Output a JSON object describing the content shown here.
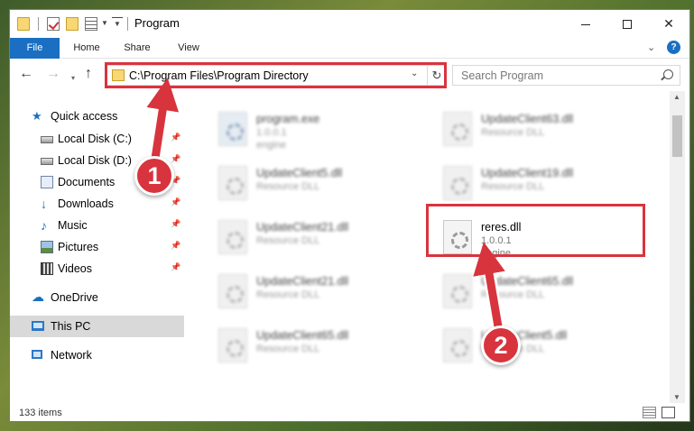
{
  "window": {
    "title": "Program",
    "controls": {
      "minimize": "",
      "maximize": "",
      "close": "✕"
    }
  },
  "ribbon": {
    "tabs": [
      "File",
      "Home",
      "Share",
      "View"
    ],
    "expand": "⌄",
    "help": "?"
  },
  "navbar": {
    "back": "←",
    "forward": "→",
    "recent": "▾",
    "up": "↑",
    "address": "C:\\Program Files\\Program Directory",
    "address_dropdown": "⌄",
    "refresh": "↻",
    "search_placeholder": "Search Program"
  },
  "sidebar": {
    "items": [
      {
        "label": "Quick access",
        "icon": "star-icon",
        "pinned": false
      },
      {
        "label": "Local Disk (C:)",
        "icon": "disk-icon",
        "pinned": true
      },
      {
        "label": "Local Disk (D:)",
        "icon": "disk-icon",
        "pinned": true
      },
      {
        "label": "Documents",
        "icon": "documents-icon",
        "pinned": true
      },
      {
        "label": "Downloads",
        "icon": "download-icon",
        "pinned": true
      },
      {
        "label": "Music",
        "icon": "music-icon",
        "pinned": true
      },
      {
        "label": "Pictures",
        "icon": "pictures-icon",
        "pinned": true
      },
      {
        "label": "Videos",
        "icon": "videos-icon",
        "pinned": true
      },
      {
        "label": "OneDrive",
        "icon": "cloud-icon",
        "pinned": false
      },
      {
        "label": "This PC",
        "icon": "computer-icon",
        "pinned": false,
        "selected": true
      },
      {
        "label": "Network",
        "icon": "network-icon",
        "pinned": false
      }
    ],
    "pin_glyph": "📌"
  },
  "files": [
    {
      "name": "program.exe",
      "line1": "1.0.0.1",
      "line2": "engine",
      "blurred": true,
      "icon": "exe-icon"
    },
    {
      "name": "UpdateClient63.dll",
      "line1": "Resource DLL",
      "line2": "",
      "blurred": true,
      "icon": "dll-icon"
    },
    {
      "name": "UpdateClient5.dll",
      "line1": "Resource DLL",
      "line2": "",
      "blurred": true,
      "icon": "dll-icon"
    },
    {
      "name": "UpdateClient19.dll",
      "line1": "Resource DLL",
      "line2": "",
      "blurred": true,
      "icon": "dll-icon"
    },
    {
      "name": "UpdateClient21.dll",
      "line1": "Resource DLL",
      "line2": "",
      "blurred": true,
      "icon": "dll-icon"
    },
    {
      "name": "reres.dll",
      "line1": "1.0.0.1",
      "line2": "engine",
      "blurred": false,
      "icon": "dll-icon"
    },
    {
      "name": "UpdateClient21.dll",
      "line1": "Resource DLL",
      "line2": "",
      "blurred": true,
      "icon": "dll-icon"
    },
    {
      "name": "UpdateClient65.dll",
      "line1": "Resource DLL",
      "line2": "",
      "blurred": true,
      "icon": "dll-icon"
    },
    {
      "name": "UpdateClient65.dll",
      "line1": "Resource DLL",
      "line2": "",
      "blurred": true,
      "icon": "dll-icon"
    },
    {
      "name": "UpdateClient5.dll",
      "line1": "Resource DLL",
      "line2": "",
      "blurred": true,
      "icon": "dll-icon"
    }
  ],
  "status": {
    "item_count": "133 items"
  },
  "annotations": {
    "step1": "1",
    "step2": "2",
    "highlight_color": "#d8343e"
  },
  "colors": {
    "accent": "#1a6fc2",
    "selection": "#d9d9d9"
  }
}
